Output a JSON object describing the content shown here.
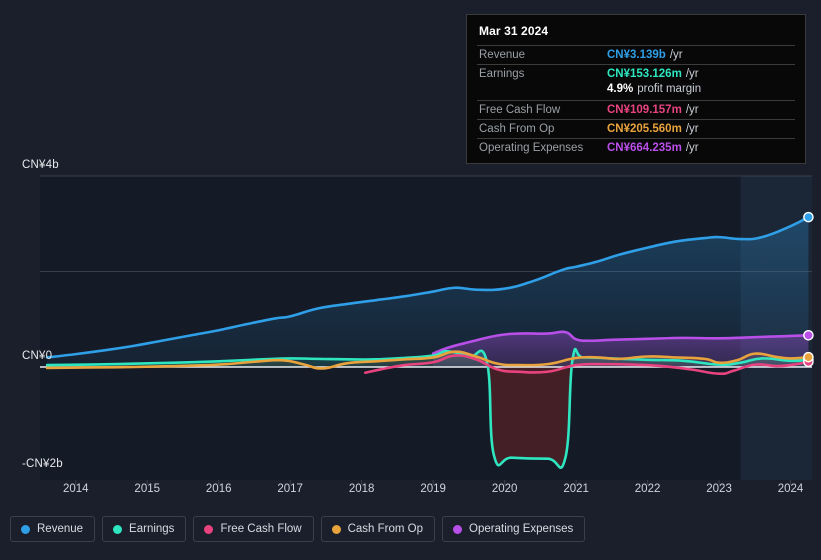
{
  "tooltip": {
    "date": "Mar 31 2024",
    "rows": [
      {
        "key": "Revenue",
        "value": "CN¥3.139b",
        "unit": "/yr",
        "color": "#2f9fe8"
      },
      {
        "key": "Earnings",
        "value": "CN¥153.126m",
        "unit": "/yr",
        "color": "#2ee6c0"
      },
      {
        "key": "Free Cash Flow",
        "value": "CN¥109.157m",
        "unit": "/yr",
        "color": "#e8437f"
      },
      {
        "key": "Cash From Op",
        "value": "CN¥205.560m",
        "unit": "/yr",
        "color": "#e8a33d"
      },
      {
        "key": "Operating Expenses",
        "value": "CN¥664.235m",
        "unit": "/yr",
        "color": "#b84fe8"
      }
    ],
    "profit_margin_value": "4.9%",
    "profit_margin_label": "profit margin"
  },
  "legend": {
    "items": [
      {
        "label": "Revenue",
        "color": "#2f9fe8"
      },
      {
        "label": "Earnings",
        "color": "#2ee6c0"
      },
      {
        "label": "Free Cash Flow",
        "color": "#e8437f"
      },
      {
        "label": "Cash From Op",
        "color": "#e8a33d"
      },
      {
        "label": "Operating Expenses",
        "color": "#b84fe8"
      }
    ]
  },
  "axis": {
    "y_top": "CN¥4b",
    "y_zero": "CN¥0",
    "y_bottom": "-CN¥2b",
    "x_labels": [
      "2014",
      "2015",
      "2016",
      "2017",
      "2018",
      "2019",
      "2020",
      "2021",
      "2022",
      "2023",
      "2024"
    ]
  },
  "chart_data": {
    "type": "line",
    "title": "",
    "xlabel": "",
    "ylabel": "CN¥",
    "ylim": [
      -2.2,
      4.0
    ],
    "xlim": [
      2013.5,
      2024.3
    ],
    "grid": true,
    "legend_position": "bottom",
    "y_ticks": [
      4,
      2,
      0,
      -2
    ],
    "y_tick_labels": [
      "CN¥4b",
      "",
      "CN¥0",
      "-CN¥2b"
    ],
    "x_ticks": [
      2014,
      2015,
      2016,
      2017,
      2018,
      2019,
      2020,
      2021,
      2022,
      2023,
      2024
    ],
    "forecast_region_start": 2023.3,
    "series": [
      {
        "name": "Revenue",
        "color": "#2f9fe8",
        "x": [
          2013.6,
          2014.0,
          2014.4,
          2014.8,
          2015.2,
          2015.6,
          2016.0,
          2016.4,
          2016.8,
          2017.0,
          2017.4,
          2017.8,
          2018.2,
          2018.6,
          2019.0,
          2019.3,
          2019.6,
          2020.0,
          2020.4,
          2020.8,
          2021.0,
          2021.3,
          2021.6,
          2022.0,
          2022.4,
          2022.8,
          2023.0,
          2023.3,
          2023.6,
          2024.0,
          2024.25
        ],
        "y": [
          0.2,
          0.27,
          0.35,
          0.44,
          0.55,
          0.66,
          0.77,
          0.9,
          1.02,
          1.06,
          1.23,
          1.32,
          1.4,
          1.48,
          1.58,
          1.66,
          1.62,
          1.64,
          1.8,
          2.03,
          2.1,
          2.21,
          2.35,
          2.5,
          2.63,
          2.7,
          2.72,
          2.68,
          2.72,
          2.95,
          3.139
        ]
      },
      {
        "name": "Earnings",
        "color": "#2ee6c0",
        "x": [
          2013.6,
          2014.2,
          2014.8,
          2015.4,
          2016.0,
          2016.6,
          2017.0,
          2017.4,
          2017.8,
          2018.2,
          2018.6,
          2019.0,
          2019.2,
          2019.5,
          2019.75,
          2019.85,
          2020.1,
          2020.6,
          2020.85,
          2020.95,
          2021.1,
          2021.5,
          2022.0,
          2022.5,
          2023.0,
          2023.3,
          2023.6,
          2024.0,
          2024.25
        ],
        "y": [
          0.04,
          0.05,
          0.07,
          0.09,
          0.12,
          0.16,
          0.18,
          0.17,
          0.16,
          0.16,
          0.19,
          0.24,
          0.33,
          0.22,
          0.12,
          -1.85,
          -1.9,
          -1.92,
          -1.9,
          0.16,
          0.2,
          0.18,
          0.15,
          0.13,
          0.05,
          0.09,
          0.18,
          0.13,
          0.153
        ]
      },
      {
        "name": "Free Cash Flow",
        "color": "#e8437f",
        "x": [
          2018.05,
          2018.3,
          2018.6,
          2019.0,
          2019.3,
          2019.6,
          2019.9,
          2020.2,
          2020.6,
          2021.0,
          2021.4,
          2021.8,
          2022.2,
          2022.6,
          2023.0,
          2023.2,
          2023.5,
          2023.8,
          2024.0,
          2024.25
        ],
        "y": [
          -0.12,
          -0.04,
          0.04,
          0.1,
          0.24,
          0.16,
          -0.05,
          -0.1,
          -0.1,
          0.04,
          0.06,
          0.05,
          0.02,
          -0.05,
          -0.14,
          -0.08,
          0.05,
          0.02,
          0.04,
          0.109
        ]
      },
      {
        "name": "Cash From Op",
        "color": "#e8a33d",
        "x": [
          2013.6,
          2014.2,
          2014.8,
          2015.4,
          2016.0,
          2016.5,
          2016.9,
          2017.2,
          2017.45,
          2017.8,
          2018.2,
          2018.6,
          2019.0,
          2019.3,
          2019.6,
          2019.9,
          2020.2,
          2020.6,
          2021.0,
          2021.3,
          2021.6,
          2022.0,
          2022.4,
          2022.8,
          2023.0,
          2023.25,
          2023.5,
          2023.8,
          2024.0,
          2024.25
        ],
        "y": [
          -0.02,
          -0.01,
          0.0,
          0.02,
          0.05,
          0.11,
          0.14,
          0.05,
          -0.03,
          0.08,
          0.12,
          0.16,
          0.2,
          0.32,
          0.22,
          0.07,
          0.04,
          0.06,
          0.19,
          0.2,
          0.17,
          0.22,
          0.2,
          0.17,
          0.09,
          0.14,
          0.28,
          0.21,
          0.18,
          0.206
        ]
      },
      {
        "name": "Operating Expenses",
        "color": "#b84fe8",
        "x": [
          2019.0,
          2019.2,
          2019.5,
          2019.9,
          2020.2,
          2020.6,
          2020.85,
          2021.0,
          2021.2,
          2021.5,
          2022.0,
          2022.5,
          2023.0,
          2023.4,
          2023.8,
          2024.0,
          2024.25
        ],
        "y": [
          0.28,
          0.4,
          0.52,
          0.66,
          0.7,
          0.7,
          0.73,
          0.58,
          0.55,
          0.57,
          0.59,
          0.61,
          0.6,
          0.62,
          0.64,
          0.65,
          0.664
        ]
      }
    ]
  }
}
